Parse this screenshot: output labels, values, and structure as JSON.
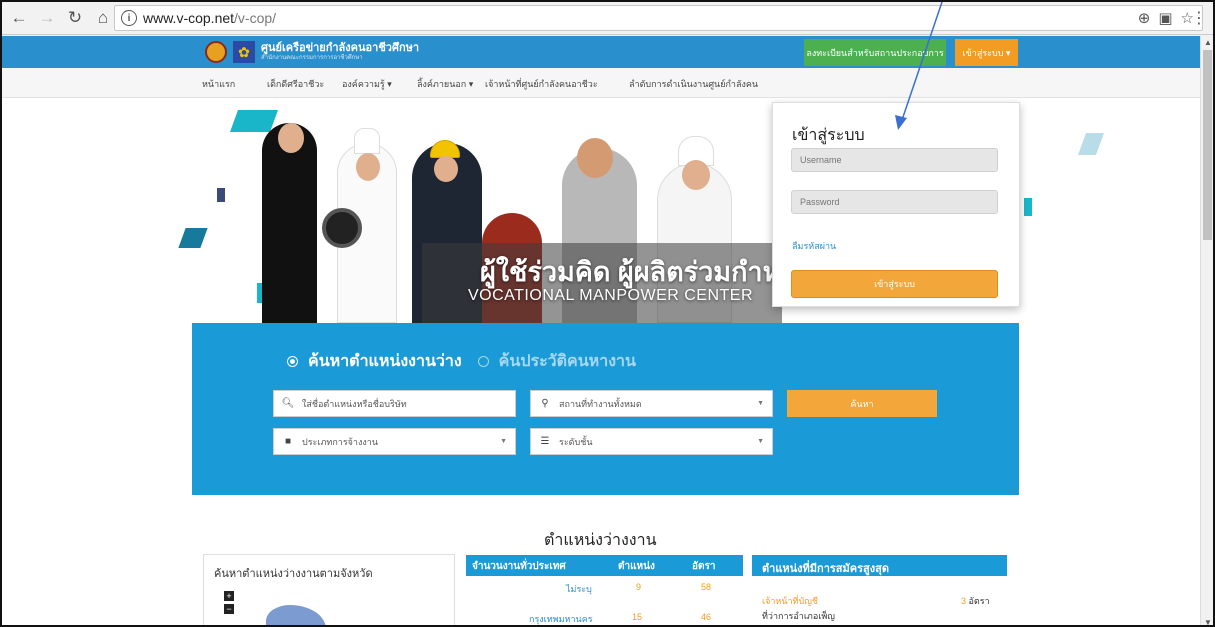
{
  "browser": {
    "back_icon": "back-arrow-icon",
    "forward_icon": "forward-arrow-icon",
    "reload_icon": "reload-icon",
    "home_icon": "home-icon",
    "url_host": "www.v-cop.net",
    "url_path": "/v-cop/"
  },
  "header": {
    "brand_title": "ศูนย์เครือข่ายกำลังคนอาชีวศึกษา",
    "brand_sub": "สำนักงานคณะกรรมการการอาชีวศึกษา",
    "register_label": "ลงทะเบียนสำหรับสถานประกอบการ",
    "login_label": "เข้าสู่ระบบ ▾"
  },
  "menu": {
    "items": [
      "หน้าแรก",
      "เด็กดีศรีอาชีวะ",
      "องค์ความรู้ ▾",
      "ลิ้งค์ภายนอก ▾",
      "เจ้าหน้าที่ศูนย์กำลังคนอาชีวะ",
      "ลำดับการดำเนินงานศูนย์กำลังคน"
    ]
  },
  "hero": {
    "title": "ผู้ใช้ร่วมคิด ผู้ผลิตร่วมกำหนด",
    "subtitle": "VOCATIONAL MANPOWER CENTER"
  },
  "login": {
    "title": "เข้าสู่ระบบ",
    "username_placeholder": "Username",
    "password_placeholder": "Password",
    "forgot": "ลืมรหัสผ่าน",
    "submit": "เข้าสู่ระบบ"
  },
  "search": {
    "tab_jobs": "ค้นหาตำแหน่งงานว่าง",
    "tab_resume": "ค้นประวัติคนหางาน",
    "keyword_placeholder": "ใส่ชื่อตำแหน่งหรือชื่อบริษัท",
    "location": "สถานที่ทำงานทั้งหมด",
    "employment_type": "ประเภทการจ้างงาน",
    "level": "ระดับชั้น",
    "search_button": "ค้นหา"
  },
  "vacancies": {
    "section_title": "ตำแหน่งว่างงาน",
    "province_box_title": "ค้นหาตำแหน่งว่างงานตามจังหวัด",
    "zoom_in": "+",
    "zoom_out": "−",
    "table_headers": [
      "จำนวนงานทั่วประเทศ",
      "ตำแหน่ง",
      "อัตรา"
    ],
    "rows": [
      {
        "province": "ไม่ระบุ",
        "positions": "9",
        "rate": "58"
      },
      {
        "province": "กรุงเทพมหานคร",
        "positions": "15",
        "rate": "46"
      }
    ],
    "top_apply_title": "ตำแหน่งที่มีการสมัครสูงสุด",
    "top_job": "เจ้าหน้าที่บัญชี",
    "top_job_count": "3",
    "top_job_unit": "อัตรา",
    "top_company": "ที่ว่าการอำเภอเพ็ญ"
  },
  "colors": {
    "topbar": "#2a8fcd",
    "search_panel": "#1a9bd7",
    "accent_orange": "#f39c24",
    "register_green": "#4caf50"
  }
}
